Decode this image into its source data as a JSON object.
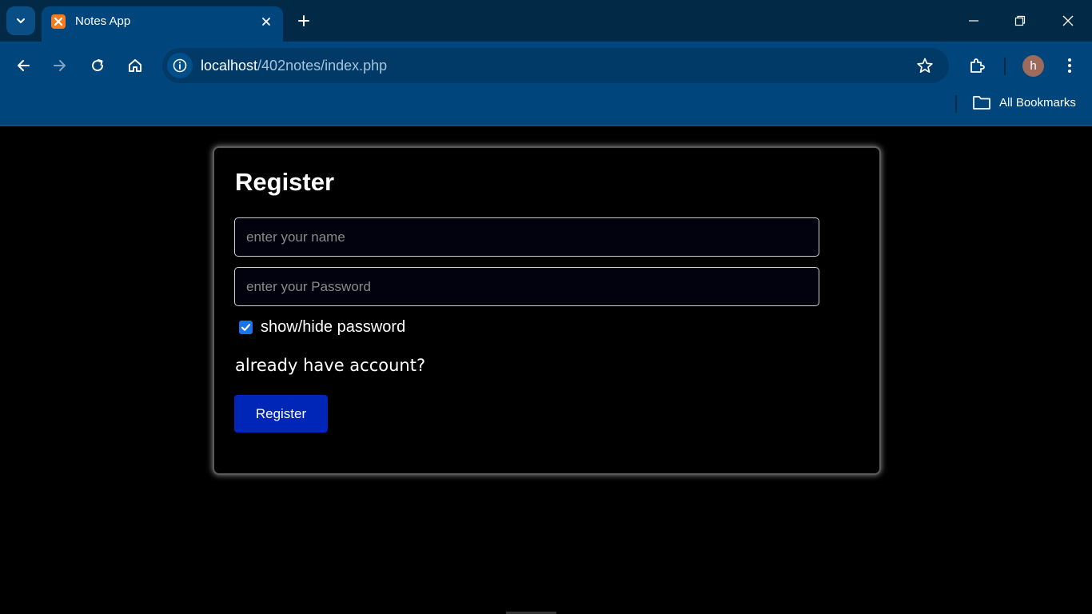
{
  "browser": {
    "tab": {
      "title": "Notes App"
    },
    "url": {
      "host": "localhost",
      "path": "/402notes/index.php"
    },
    "bookmarks_label": "All Bookmarks",
    "profile_initial": "h"
  },
  "page": {
    "title": "Register",
    "name_placeholder": "enter your name",
    "password_placeholder": "enter your Password",
    "show_password_label": "show/hide password",
    "show_password_checked": true,
    "login_link": "already have account?",
    "submit_label": "Register"
  },
  "colors": {
    "chrome_bg": "#00467d",
    "tabstrip_bg": "#022a47",
    "button_bg": "#0026b8",
    "checkbox": "#1a73e8"
  }
}
